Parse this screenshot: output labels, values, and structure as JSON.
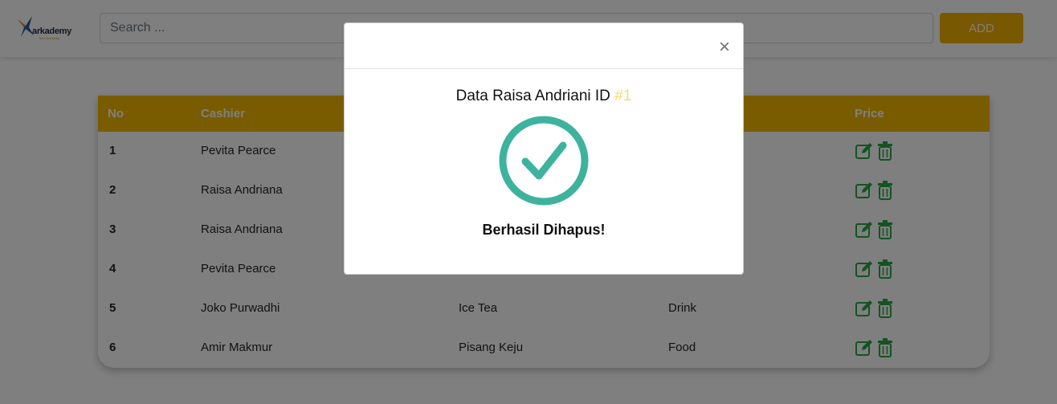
{
  "header": {
    "logo_text": "arkademy",
    "logo_sub": "Tech Academy",
    "search_placeholder": "Search ...",
    "add_label": "ADD"
  },
  "table": {
    "headers": {
      "no": "No",
      "cashier": "Cashier",
      "price": "Price"
    },
    "rows": [
      {
        "no": "1",
        "cashier": "Pevita Pearce",
        "product": "",
        "category": ""
      },
      {
        "no": "2",
        "cashier": "Raisa Andriana",
        "product": "",
        "category": ""
      },
      {
        "no": "3",
        "cashier": "Raisa Andriana",
        "product": "",
        "category": ""
      },
      {
        "no": "4",
        "cashier": "Pevita Pearce",
        "product": "",
        "category": ""
      },
      {
        "no": "5",
        "cashier": "Joko Purwadhi",
        "product": "Ice Tea",
        "category": "Drink"
      },
      {
        "no": "6",
        "cashier": "Amir Makmur",
        "product": "Pisang Keju",
        "category": "Food"
      }
    ]
  },
  "modal": {
    "close_label": "×",
    "title_prefix": "Data Raisa Andriani ID",
    "title_id": "#1",
    "message": "Berhasil Dihapus!"
  },
  "colors": {
    "accent": "#f5b800",
    "success": "#3db39e",
    "action_icon": "#28a745"
  },
  "icons": {
    "edit": "edit-icon",
    "delete": "trash-icon",
    "success": "check-circle-icon"
  }
}
